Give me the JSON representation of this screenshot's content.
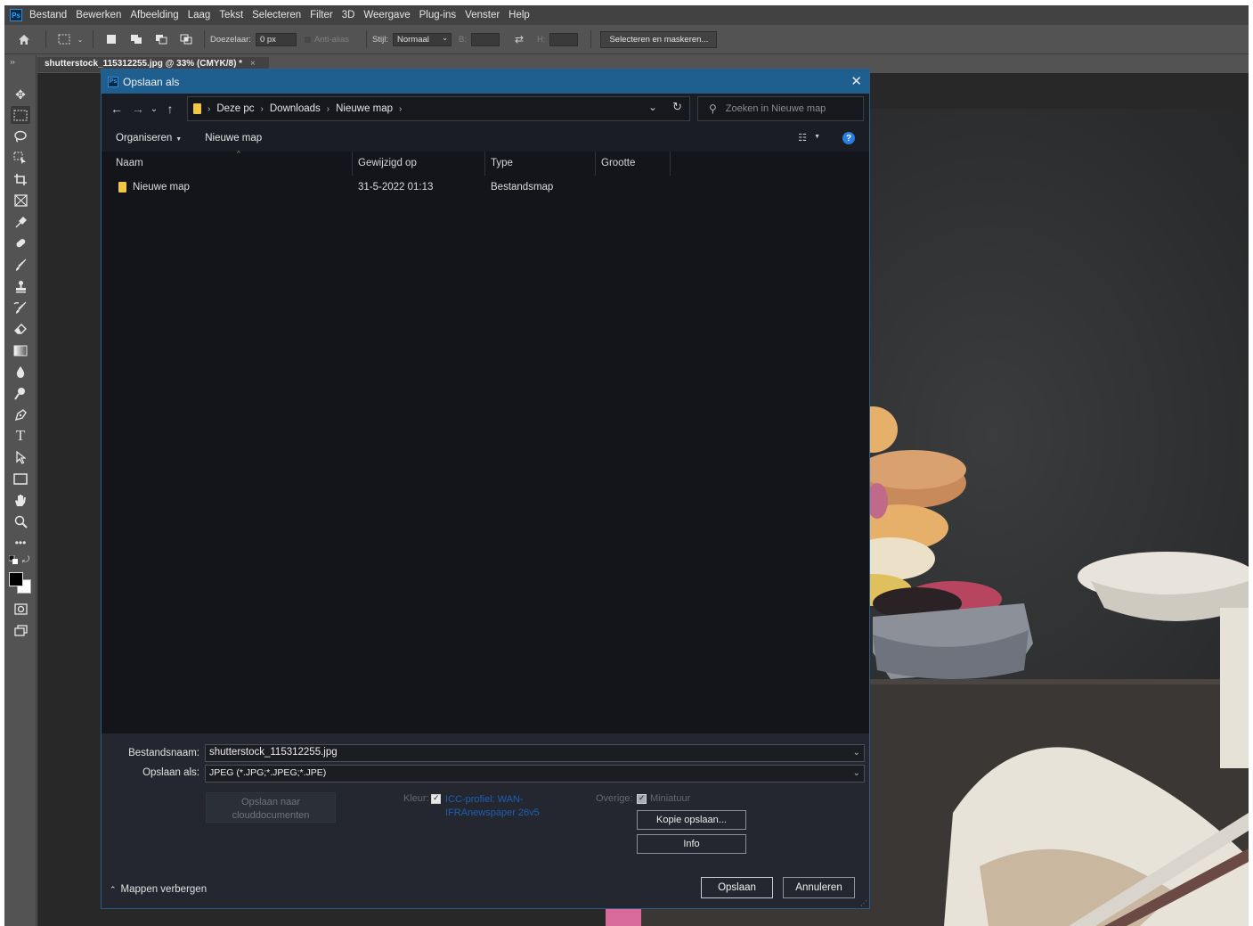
{
  "menubar": {
    "logo": "Ps",
    "items": [
      "Bestand",
      "Bewerken",
      "Afbeelding",
      "Laag",
      "Tekst",
      "Selecteren",
      "Filter",
      "3D",
      "Weergave",
      "Plug-ins",
      "Venster",
      "Help"
    ]
  },
  "options": {
    "feather_label": "Doezelaar:",
    "feather_value": "0 px",
    "antialias_label": "Anti-alias",
    "style_label": "Stijl:",
    "style_value": "Normaal",
    "width_label": "B:",
    "height_label": "H:",
    "select_mask_label": "Selecteren en maskeren..."
  },
  "document": {
    "tab_title": "shutterstock_115312255.jpg @ 33% (CMYK/8) *",
    "tab_close": "×"
  },
  "dialog": {
    "title": "Opslaan als",
    "address": {
      "crumbs": [
        "Deze pc",
        "Downloads",
        "Nieuwe map"
      ]
    },
    "search_placeholder": "Zoeken in Nieuwe map",
    "commands": {
      "organize": "Organiseren",
      "new_folder": "Nieuwe map"
    },
    "columns": [
      "Naam",
      "Gewijzigd op",
      "Type",
      "Grootte"
    ],
    "files": [
      {
        "name": "Nieuwe map",
        "modified": "31-5-2022 01:13",
        "type": "Bestandsmap",
        "size": ""
      }
    ],
    "filename_label": "Bestandsnaam:",
    "filename_value": "shutterstock_115312255.jpg",
    "saveas_label": "Opslaan als:",
    "saveas_value": "JPEG (*.JPG;*.JPEG;*.JPE)",
    "cloud_button": [
      "Opslaan naar",
      "clouddocumenten"
    ],
    "color_label": "Kleur:",
    "icc_text": "ICC-profiel: WAN-IFRAnewspaper 26v5",
    "other_label": "Overige:",
    "thumbnail_label": "Miniatuur",
    "copy_button": "Kopie opslaan...",
    "info_button": "Info",
    "hide_folders": "Mappen verbergen",
    "save_button": "Opslaan",
    "cancel_button": "Annuleren"
  },
  "colors": {
    "dialog_titlebar": "#1e5f8f",
    "help_icon": "#2a7de1",
    "folder": "#f2c744",
    "icc_link": "#1d5fb3"
  }
}
